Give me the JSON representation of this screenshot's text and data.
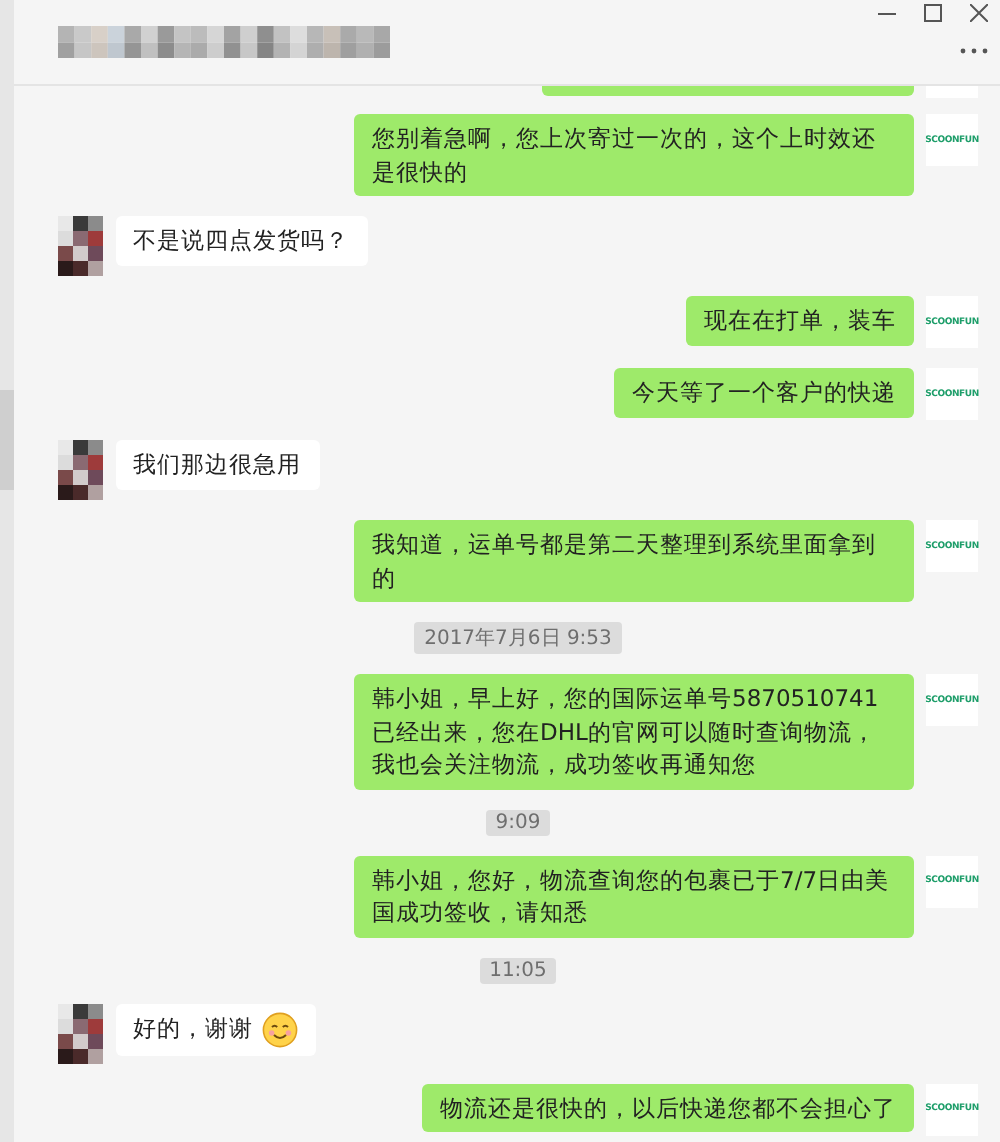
{
  "messages": [
    {
      "kind": "partial"
    },
    {
      "kind": "sent",
      "text": "您别着急啊，您上次寄过一次的，这个上时效还是很快的",
      "avatar_label": "SCOONFUN"
    },
    {
      "kind": "received",
      "text": "不是说四点发货吗？"
    },
    {
      "kind": "sent",
      "text": "现在在打单，装车",
      "avatar_label": "SCOONFUN"
    },
    {
      "kind": "sent",
      "text": "今天等了一个客户的快递",
      "avatar_label": "SCOONFUN"
    },
    {
      "kind": "received",
      "text": "我们那边很急用"
    },
    {
      "kind": "sent",
      "text": "我知道，运单号都是第二天整理到系统里面拿到的",
      "avatar_label": "SCOONFUN"
    },
    {
      "kind": "time",
      "text": "2017年7月6日 9:53"
    },
    {
      "kind": "sent",
      "text": "韩小姐，早上好，您的国际运单号5870510741已经出来，您在DHL的官网可以随时查询物流，我也会关注物流，成功签收再通知您",
      "avatar_label": "SCOONFUN"
    },
    {
      "kind": "time",
      "text": "9:09"
    },
    {
      "kind": "sent",
      "text": "韩小姐，您好，物流查询您的包裹已于7/7日由美国成功签收，请知悉",
      "avatar_label": "SCOONFUN"
    },
    {
      "kind": "time",
      "text": "11:05"
    },
    {
      "kind": "received",
      "text": "好的，谢谢",
      "emoji": true
    },
    {
      "kind": "sent",
      "text": "物流还是很快的，以后快递您都不会担心了",
      "avatar_label": "SCOONFUN"
    }
  ]
}
